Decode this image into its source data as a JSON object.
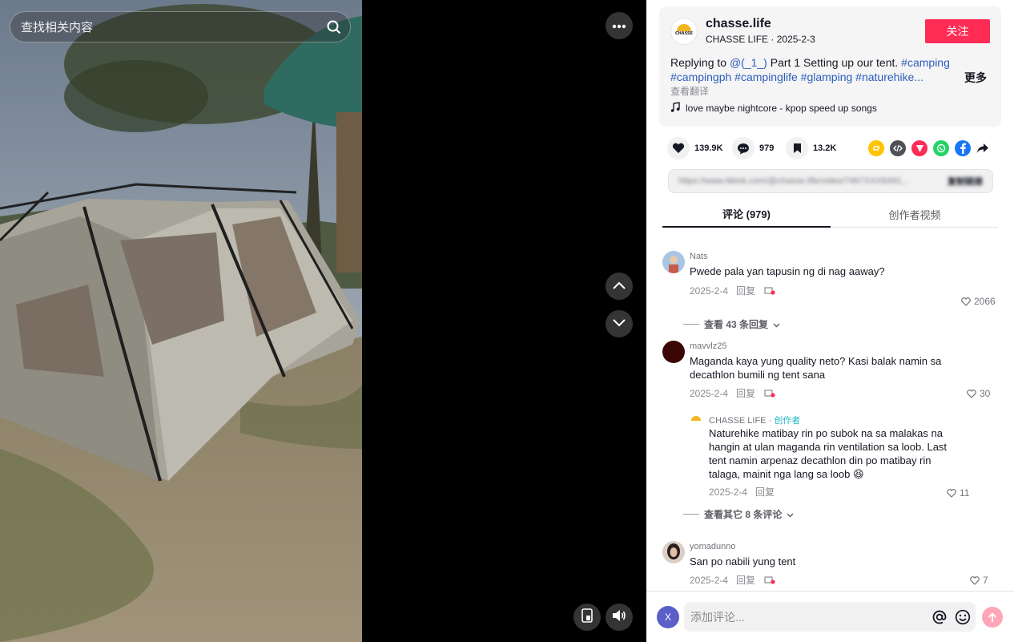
{
  "video": {
    "search_placeholder": "查找相关内容"
  },
  "author": {
    "name": "chasse.life",
    "display_name": "CHASSE LIFE",
    "date": "2025-2-3",
    "logo_text": "CHASSE",
    "follow_label": "关注"
  },
  "caption": {
    "prefix": "Replying to ",
    "mention": "@(_1_)",
    "text": " Part 1 Setting up our tent. ",
    "tags": [
      "#camping",
      "#campingph",
      "#campinglife",
      "#glamping",
      "#naturehike..."
    ],
    "more": "更多",
    "translate": "查看翻译",
    "music": "love maybe nightcore - kpop speed up songs"
  },
  "stats": {
    "likes": "139.9K",
    "comments": "979",
    "saves": "13.2K"
  },
  "share_colors": {
    "repost": "#ffc300",
    "embed": "#4f5057",
    "send": "#fe2c55",
    "whatsapp": "#25d366",
    "facebook": "#1877f2"
  },
  "link": {
    "url": "https://www.tiktok.com/@chasse.life/video/7467XXX8491...",
    "copy_label": "复制链接"
  },
  "tabs": [
    {
      "label": "评论 (979)"
    },
    {
      "label": "创作者视频"
    }
  ],
  "comments": [
    {
      "user": "Nats",
      "text": "Pwede pala yan tapusin ng di nag aaway?",
      "date": "2025-2-4",
      "reply": "回复",
      "likes": "2066",
      "view_replies": "查看 43 条回复"
    },
    {
      "user": "mavvlz25",
      "text": "Maganda kaya yung quality neto? Kasi balak namin sa decathlon bumili ng tent sana",
      "date": "2025-2-4",
      "reply": "回复",
      "likes": "30",
      "sub_reply": {
        "user": "CHASSE LIFE",
        "separator": " · ",
        "badge": "创作者",
        "text": "Naturehike matibay rin po subok na sa malakas na hangin at ulan maganda rin ventilation sa loob. Last tent namin arpenaz decathlon din po matibay rin talaga, mainit nga lang sa loob 😆",
        "date": "2025-2-4",
        "reply": "回复",
        "likes": "11"
      },
      "view_replies": "查看其它 8 条评论"
    },
    {
      "user": "yomadunno",
      "text": "San po nabili yung tent",
      "date": "2025-2-4",
      "reply": "回复",
      "likes": "7"
    }
  ],
  "composer": {
    "avatar_letter": "X",
    "placeholder": "添加评论..."
  }
}
